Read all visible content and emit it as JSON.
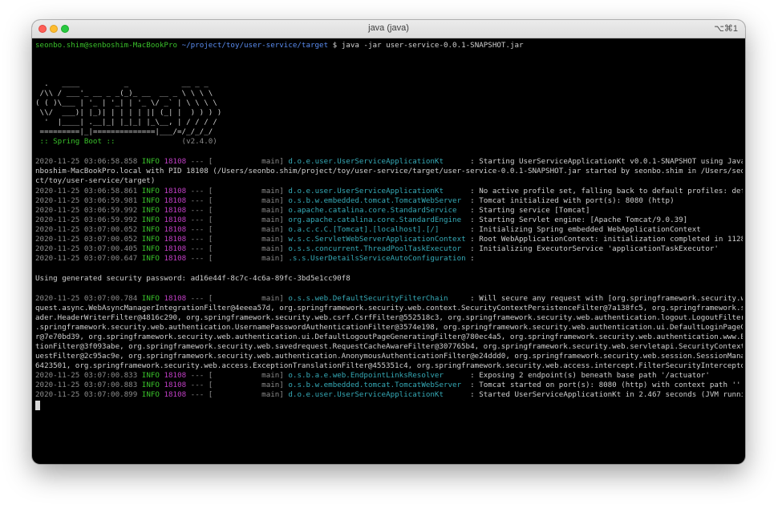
{
  "window": {
    "title": "java (java)",
    "shortcut": "⌥⌘1"
  },
  "prompt": {
    "user_host": "seonbo.shim@senboshim-MacBookPro",
    "path": "~/project/toy/user-service/target",
    "symbol": "$",
    "command": "java -jar user-service-0.0.1-SNAPSHOT.jar"
  },
  "banner": {
    "lines": [
      "  .   ____          _            __ _ _",
      " /\\\\ / ___'_ __ _ _(_)_ __  __ _ \\ \\ \\ \\",
      "( ( )\\___ | '_ | '_| | '_ \\/ _` | \\ \\ \\ \\",
      " \\\\/  ___)| |_)| | | | | || (_| |  ) ) ) )",
      "  '  |____| .__|_| |_|_| |_\\__, | / / / /",
      " =========|_|==============|___/=/_/_/_/"
    ],
    "boot_label": " :: Spring Boot :: ",
    "boot_version": "              (v2.4.0)"
  },
  "logs": [
    {
      "ts": "2020-11-25 03:06:58.858",
      "level": "INFO",
      "pid": "18108",
      "sep": " --- [           main] ",
      "logger": "d.o.e.user.UserServiceApplicationKt     ",
      "msg": " : Starting UserServiceApplicationKt v0.0.1-SNAPSHOT using Java 11.0.8 on se"
    },
    {
      "ts": "2020-11-25 03:06:58.861",
      "level": "INFO",
      "pid": "18108",
      "sep": " --- [           main] ",
      "logger": "d.o.e.user.UserServiceApplicationKt     ",
      "msg": " : No active profile set, falling back to default profiles: default"
    },
    {
      "ts": "2020-11-25 03:06:59.981",
      "level": "INFO",
      "pid": "18108",
      "sep": " --- [           main] ",
      "logger": "o.s.b.w.embedded.tomcat.TomcatWebServer ",
      "msg": " : Tomcat initialized with port(s): 8080 (http)"
    },
    {
      "ts": "2020-11-25 03:06:59.992",
      "level": "INFO",
      "pid": "18108",
      "sep": " --- [           main] ",
      "logger": "o.apache.catalina.core.StandardService  ",
      "msg": " : Starting service [Tomcat]"
    },
    {
      "ts": "2020-11-25 03:06:59.992",
      "level": "INFO",
      "pid": "18108",
      "sep": " --- [           main] ",
      "logger": "org.apache.catalina.core.StandardEngine ",
      "msg": " : Starting Servlet engine: [Apache Tomcat/9.0.39]"
    },
    {
      "ts": "2020-11-25 03:07:00.052",
      "level": "INFO",
      "pid": "18108",
      "sep": " --- [           main] ",
      "logger": "o.a.c.c.C.[Tomcat].[localhost].[/]      ",
      "msg": " : Initializing Spring embedded WebApplicationContext"
    },
    {
      "ts": "2020-11-25 03:07:00.052",
      "level": "INFO",
      "pid": "18108",
      "sep": " --- [           main] ",
      "logger": "w.s.c.ServletWebServerApplicationContext",
      "msg": " : Root WebApplicationContext: initialization completed in 1128 ms"
    },
    {
      "ts": "2020-11-25 03:07:00.405",
      "level": "INFO",
      "pid": "18108",
      "sep": " --- [           main] ",
      "logger": "o.s.s.concurrent.ThreadPoolTaskExecutor ",
      "msg": " : Initializing ExecutorService 'applicationTaskExecutor'"
    },
    {
      "ts": "2020-11-25 03:07:00.647",
      "level": "INFO",
      "pid": "18108",
      "sep": " --- [           main] ",
      "logger": ".s.s.UserDetailsServiceAutoConfiguration",
      "msg": " : "
    },
    {
      "ts": "2020-11-25 03:07:00.784",
      "level": "INFO",
      "pid": "18108",
      "sep": " --- [           main] ",
      "logger": "o.s.s.web.DefaultSecurityFilterChain    ",
      "msg": " : Will secure any request with [org.springframework.security.web.context.re"
    },
    {
      "ts": "2020-11-25 03:07:00.833",
      "level": "INFO",
      "pid": "18108",
      "sep": " --- [           main] ",
      "logger": "o.s.b.a.e.web.EndpointLinksResolver     ",
      "msg": " : Exposing 2 endpoint(s) beneath base path '/actuator'"
    },
    {
      "ts": "2020-11-25 03:07:00.883",
      "level": "INFO",
      "pid": "18108",
      "sep": " --- [           main] ",
      "logger": "o.s.b.w.embedded.tomcat.TomcatWebServer ",
      "msg": " : Tomcat started on port(s): 8080 (http) with context path ''"
    },
    {
      "ts": "2020-11-25 03:07:00.899",
      "level": "INFO",
      "pid": "18108",
      "sep": " --- [           main] ",
      "logger": "d.o.e.user.UserServiceApplicationKt     ",
      "msg": " : Started UserServiceApplicationKt in 2.467 seconds (JVM running for 2.873)"
    }
  ],
  "wrap_start": [
    "nboshim-MacBookPro.local with PID 18108 (/Users/seonbo.shim/project/toy/user-service/target/user-service-0.0.1-SNAPSHOT.jar started by seonbo.shim in /Users/seonbo.shim/proje",
    "ct/toy/user-service/target)"
  ],
  "security_password": "Using generated security password: ad16e44f-8c7c-4c6a-89fc-3bd5e1cc90f8",
  "wrap_filters": [
    "quest.async.WebAsyncManagerIntegrationFilter@4eeea57d, org.springframework.security.web.context.SecurityContextPersistenceFilter@7a138fc5, org.springframework.security.web.he",
    "ader.HeaderWriterFilter@4816c290, org.springframework.security.web.csrf.CsrfFilter@552518c3, org.springframework.security.web.authentication.logout.LogoutFilter@61d9efe0, org",
    ".springframework.security.web.authentication.UsernamePasswordAuthenticationFilter@3574e198, org.springframework.security.web.authentication.ui.DefaultLoginPageGeneratingFilte",
    "r@7e70bd39, org.springframework.security.web.authentication.ui.DefaultLogoutPageGeneratingFilter@780ec4a5, org.springframework.security.web.authentication.www.BasicAuthentica",
    "tionFilter@3f093abe, org.springframework.security.web.savedrequest.RequestCacheAwareFilter@307765b4, org.springframework.security.web.servletapi.SecurityContextHolderAwareReq",
    "uestFilter@2c95ac9e, org.springframework.security.web.authentication.AnonymousAuthenticationFilter@e24ddd0, org.springframework.security.web.session.SessionManagementFilter@1",
    "6423501, org.springframework.security.web.access.ExceptionTranslationFilter@455351c4, org.springframework.security.web.access.intercept.FilterSecurityInterceptor@27e0f2f5]"
  ],
  "colors": {
    "green": "#39c02a",
    "blue": "#5a8cf0",
    "magenta": "#c13fc5",
    "cyan": "#35a9b6",
    "dim": "#8c8c8c",
    "background": "#000000"
  }
}
